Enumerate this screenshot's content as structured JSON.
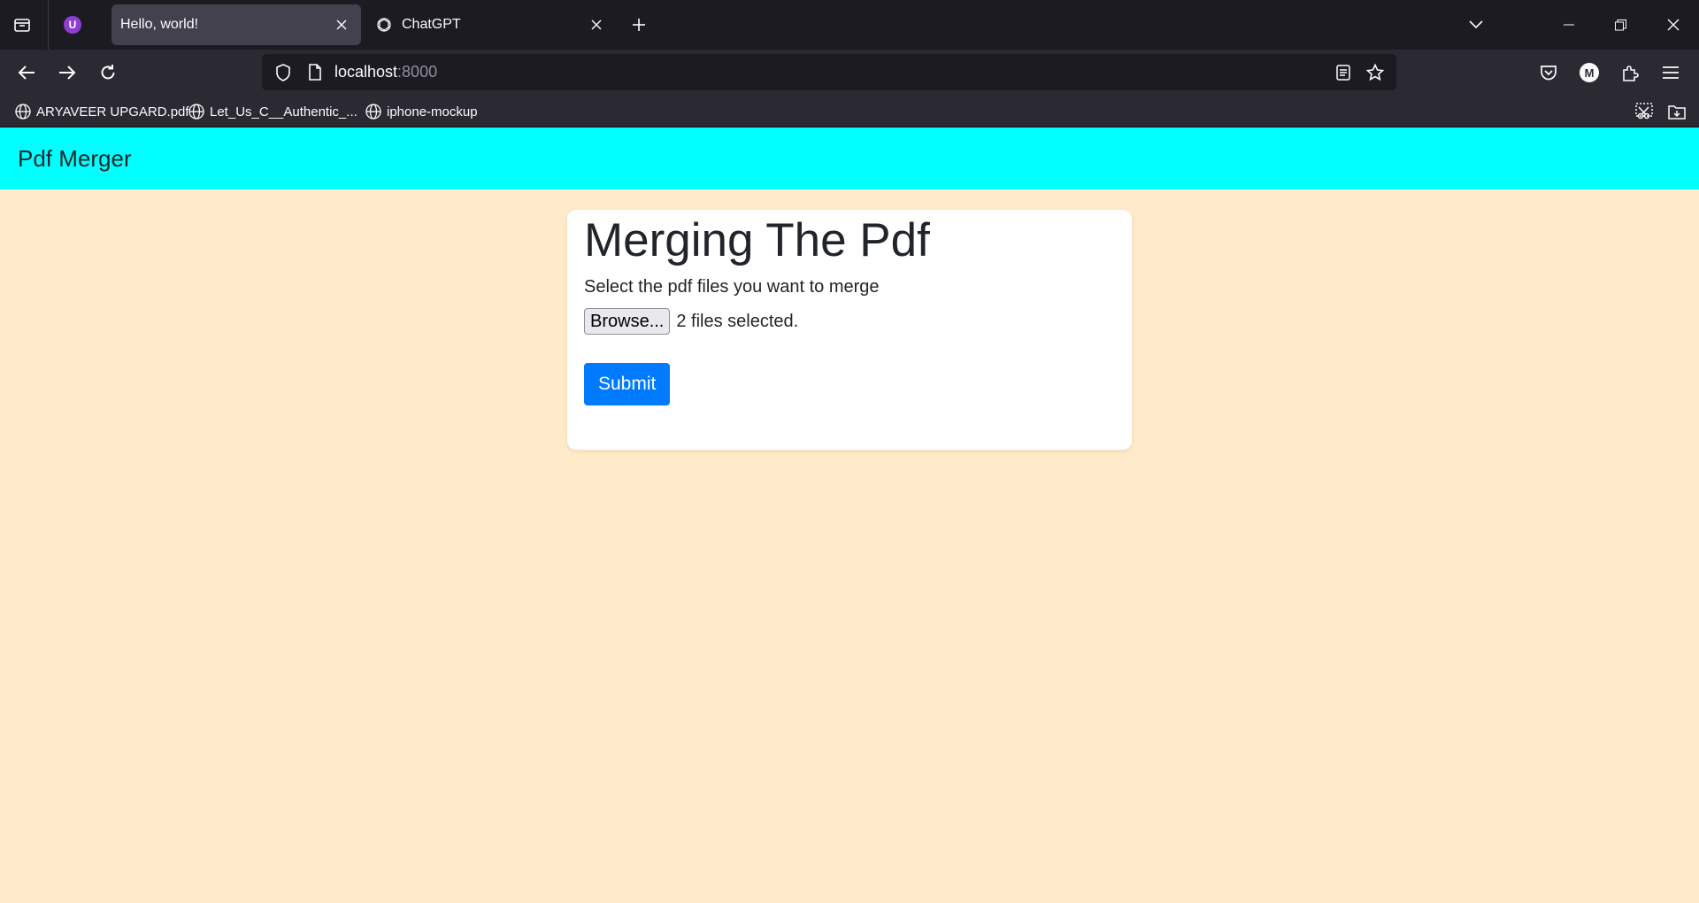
{
  "browser": {
    "tabs": [
      {
        "title": "Hello, world!",
        "active": true
      },
      {
        "title": "ChatGPT",
        "active": false
      }
    ],
    "pinned_ext_badge": "U",
    "url": {
      "host": "localhost",
      "port": ":8000"
    },
    "account_initial": "M",
    "bookmarks": [
      {
        "label": "ARYAVEER UPGARD.pdf",
        "icon": "globe-icon"
      },
      {
        "label": "Let_Us_C__Authentic_...",
        "icon": "globe-icon"
      },
      {
        "label": "iphone-mockup",
        "icon": "globe-icon"
      }
    ]
  },
  "page": {
    "brand": "Pdf Merger",
    "heading": "Merging The Pdf",
    "instruction": "Select the pdf files you want to merge",
    "browse_label": "Browse...",
    "file_status": "2 files selected.",
    "submit_label": "Submit"
  },
  "colors": {
    "navbar_bg": "#00ffff",
    "page_bg": "#ffebc9",
    "submit_bg": "#007bff"
  }
}
